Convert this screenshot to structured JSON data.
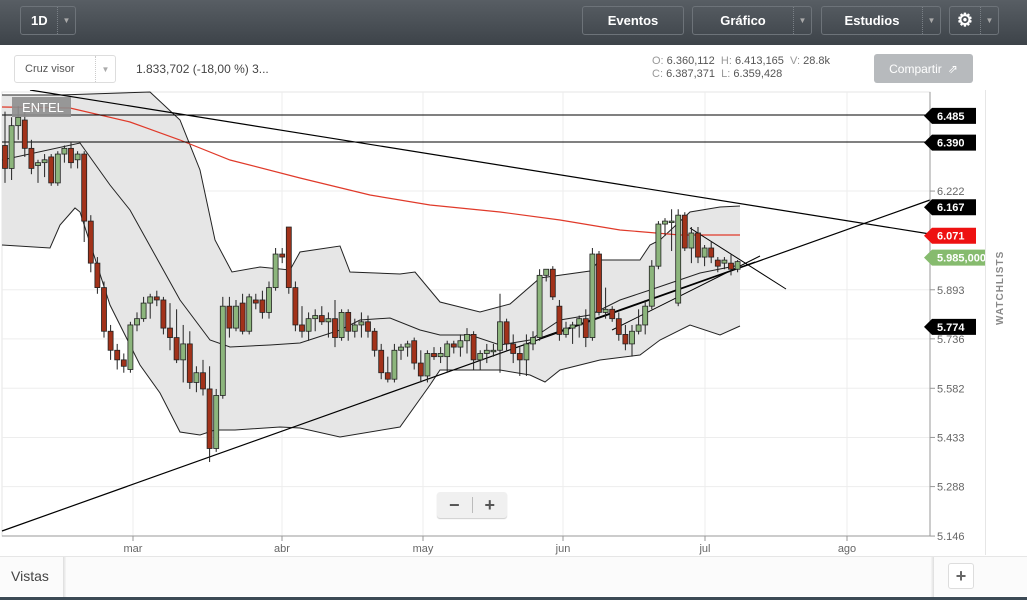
{
  "toolbar": {
    "interval": "1D",
    "eventos": "Eventos",
    "grafico": "Gráfico",
    "estudios": "Estudios",
    "settings_icon": "gear-icon"
  },
  "subbar": {
    "crosshair": "Cruz visor",
    "stat": "1.833,702 (-18,00 %) 3...",
    "O": "6.360,112",
    "H": "6.413,165",
    "V": "28.8k",
    "C": "6.387,371",
    "L": "6.359,428",
    "share": "Compartir"
  },
  "symbol": "ENTEL",
  "watchlists": "WATCHLISTS",
  "zoom": {
    "minus": "−",
    "plus": "+"
  },
  "vistas": {
    "label": "Vistas",
    "add": "+"
  },
  "chart_data": {
    "type": "candlestick",
    "x_ticks": [
      "mar",
      "abr",
      "may",
      "jun",
      "jul",
      "ago"
    ],
    "y_ticks": [
      "6.222",
      "5.893",
      "5.736",
      "5.582",
      "5.433",
      "5.288",
      "5.146"
    ],
    "y_tick_values": [
      6.222,
      5.893,
      5.736,
      5.582,
      5.433,
      5.288,
      5.146
    ],
    "y_scale": "log",
    "price_labels": [
      {
        "text": "6.485",
        "value": 6.485,
        "color": "#000000"
      },
      {
        "text": "6.390",
        "value": 6.39,
        "color": "#000000"
      },
      {
        "text": "6.167",
        "value": 6.167,
        "color": "#000000"
      },
      {
        "text": "6.071",
        "value": 6.071,
        "color": "#ee1111"
      },
      {
        "text": "5.774",
        "value": 5.774,
        "color": "#000000"
      },
      {
        "text": "5.985,000",
        "value": 5.985,
        "color": "#86bb6e"
      }
    ],
    "up_color": "#8cb57c",
    "down_color": "#a2321a",
    "ohlc": [
      [
        6.38,
        6.5,
        6.25,
        6.3
      ],
      [
        6.3,
        6.48,
        6.26,
        6.45
      ],
      [
        6.45,
        6.52,
        6.4,
        6.48
      ],
      [
        6.47,
        6.5,
        6.34,
        6.37
      ],
      [
        6.37,
        6.4,
        6.28,
        6.3
      ],
      [
        6.31,
        6.33,
        6.25,
        6.32
      ],
      [
        6.32,
        6.35,
        6.27,
        6.33
      ],
      [
        6.34,
        6.35,
        6.24,
        6.25
      ],
      [
        6.25,
        6.36,
        6.24,
        6.35
      ],
      [
        6.35,
        6.38,
        6.32,
        6.37
      ],
      [
        6.37,
        6.39,
        6.3,
        6.32
      ],
      [
        6.33,
        6.36,
        6.3,
        6.35
      ],
      [
        6.35,
        6.36,
        6.05,
        6.12
      ],
      [
        6.12,
        6.14,
        5.95,
        5.98
      ],
      [
        5.98,
        6.0,
        5.88,
        5.9
      ],
      [
        5.9,
        5.92,
        5.74,
        5.76
      ],
      [
        5.76,
        5.78,
        5.67,
        5.7
      ],
      [
        5.7,
        5.72,
        5.64,
        5.67
      ],
      [
        5.67,
        5.69,
        5.63,
        5.65
      ],
      [
        5.64,
        5.79,
        5.63,
        5.78
      ],
      [
        5.78,
        5.82,
        5.76,
        5.8
      ],
      [
        5.8,
        5.87,
        5.79,
        5.85
      ],
      [
        5.85,
        5.88,
        5.8,
        5.87
      ],
      [
        5.87,
        5.89,
        5.84,
        5.86
      ],
      [
        5.86,
        5.87,
        5.75,
        5.77
      ],
      [
        5.77,
        5.85,
        5.7,
        5.74
      ],
      [
        5.74,
        5.83,
        5.66,
        5.67
      ],
      [
        5.67,
        5.78,
        5.6,
        5.72
      ],
      [
        5.72,
        5.76,
        5.58,
        5.6
      ],
      [
        5.6,
        5.65,
        5.57,
        5.63
      ],
      [
        5.63,
        5.67,
        5.56,
        5.58
      ],
      [
        5.58,
        5.65,
        5.36,
        5.4
      ],
      [
        5.4,
        5.58,
        5.39,
        5.56
      ],
      [
        5.56,
        5.87,
        5.55,
        5.84
      ],
      [
        5.84,
        5.87,
        5.74,
        5.77
      ],
      [
        5.77,
        5.86,
        5.76,
        5.84
      ],
      [
        5.85,
        5.88,
        5.75,
        5.76
      ],
      [
        5.76,
        5.88,
        5.75,
        5.87
      ],
      [
        5.86,
        5.88,
        5.83,
        5.85
      ],
      [
        5.86,
        5.89,
        5.8,
        5.82
      ],
      [
        5.82,
        5.92,
        5.8,
        5.9
      ],
      [
        5.9,
        6.03,
        5.89,
        6.01
      ],
      [
        6.01,
        6.03,
        5.98,
        6.0
      ],
      [
        6.1,
        6.1,
        5.88,
        5.9
      ],
      [
        5.9,
        5.92,
        5.76,
        5.78
      ],
      [
        5.78,
        5.84,
        5.74,
        5.76
      ],
      [
        5.76,
        5.82,
        5.73,
        5.8
      ],
      [
        5.8,
        5.83,
        5.76,
        5.81
      ],
      [
        5.81,
        5.84,
        5.78,
        5.79
      ],
      [
        5.79,
        5.82,
        5.74,
        5.8
      ],
      [
        5.8,
        5.86,
        5.71,
        5.74
      ],
      [
        5.74,
        5.83,
        5.73,
        5.82
      ],
      [
        5.82,
        5.83,
        5.73,
        5.76
      ],
      [
        5.76,
        5.8,
        5.74,
        5.78
      ],
      [
        5.78,
        5.82,
        5.74,
        5.79
      ],
      [
        5.79,
        5.81,
        5.74,
        5.76
      ],
      [
        5.76,
        5.77,
        5.68,
        5.7
      ],
      [
        5.7,
        5.72,
        5.61,
        5.63
      ],
      [
        5.63,
        5.68,
        5.6,
        5.61
      ],
      [
        5.61,
        5.72,
        5.6,
        5.7
      ],
      [
        5.7,
        5.72,
        5.67,
        5.71
      ],
      [
        5.71,
        5.73,
        5.68,
        5.72
      ],
      [
        5.73,
        5.74,
        5.64,
        5.66
      ],
      [
        5.66,
        5.7,
        5.6,
        5.62
      ],
      [
        5.62,
        5.7,
        5.6,
        5.69
      ],
      [
        5.69,
        5.71,
        5.67,
        5.68
      ],
      [
        5.68,
        5.71,
        5.66,
        5.69
      ],
      [
        5.68,
        5.73,
        5.63,
        5.72
      ],
      [
        5.72,
        5.73,
        5.69,
        5.71
      ],
      [
        5.71,
        5.75,
        5.68,
        5.73
      ],
      [
        5.73,
        5.77,
        5.69,
        5.75
      ],
      [
        5.75,
        5.76,
        5.64,
        5.67
      ],
      [
        5.67,
        5.7,
        5.64,
        5.69
      ],
      [
        5.69,
        5.72,
        5.66,
        5.7
      ],
      [
        5.7,
        5.72,
        5.68,
        5.7
      ],
      [
        5.7,
        5.88,
        5.63,
        5.79
      ],
      [
        5.79,
        5.8,
        5.7,
        5.72
      ],
      [
        5.72,
        5.75,
        5.66,
        5.69
      ],
      [
        5.69,
        5.71,
        5.62,
        5.67
      ],
      [
        5.67,
        5.75,
        5.62,
        5.72
      ],
      [
        5.72,
        5.76,
        5.7,
        5.74
      ],
      [
        5.74,
        5.96,
        5.73,
        5.94
      ],
      [
        5.94,
        5.96,
        5.92,
        5.96
      ],
      [
        5.96,
        5.97,
        5.86,
        5.87
      ],
      [
        5.84,
        5.86,
        5.73,
        5.75
      ],
      [
        5.75,
        5.79,
        5.74,
        5.77
      ],
      [
        5.77,
        5.79,
        5.72,
        5.78
      ],
      [
        5.78,
        5.81,
        5.74,
        5.8
      ],
      [
        5.8,
        5.83,
        5.71,
        5.74
      ],
      [
        5.74,
        6.03,
        5.73,
        6.01
      ],
      [
        6.01,
        6.02,
        5.81,
        5.82
      ],
      [
        5.82,
        5.9,
        5.8,
        5.83
      ],
      [
        5.83,
        5.84,
        5.79,
        5.8
      ],
      [
        5.8,
        5.82,
        5.73,
        5.75
      ],
      [
        5.75,
        5.78,
        5.7,
        5.72
      ],
      [
        5.72,
        5.78,
        5.68,
        5.76
      ],
      [
        5.76,
        5.83,
        5.75,
        5.78
      ],
      [
        5.78,
        5.86,
        5.75,
        5.84
      ],
      [
        5.84,
        5.99,
        5.83,
        5.97
      ],
      [
        5.97,
        6.12,
        5.96,
        6.11
      ],
      [
        6.11,
        6.13,
        6.07,
        6.12
      ],
      [
        6.12,
        6.16,
        6.02,
        6.12
      ],
      [
        5.85,
        6.16,
        5.84,
        6.14
      ],
      [
        6.14,
        6.15,
        6.02,
        6.03
      ],
      [
        6.03,
        6.1,
        5.98,
        6.08
      ],
      [
        6.08,
        6.1,
        5.98,
        6.0
      ],
      [
        6.0,
        6.04,
        5.97,
        6.03
      ],
      [
        6.03,
        6.05,
        5.98,
        6.0
      ],
      [
        5.99,
        6.0,
        5.95,
        5.97
      ],
      [
        5.98,
        6.0,
        5.96,
        5.99
      ],
      [
        5.98,
        6.01,
        5.94,
        5.96
      ],
      [
        5.96,
        5.99,
        5.95,
        5.985
      ]
    ]
  }
}
